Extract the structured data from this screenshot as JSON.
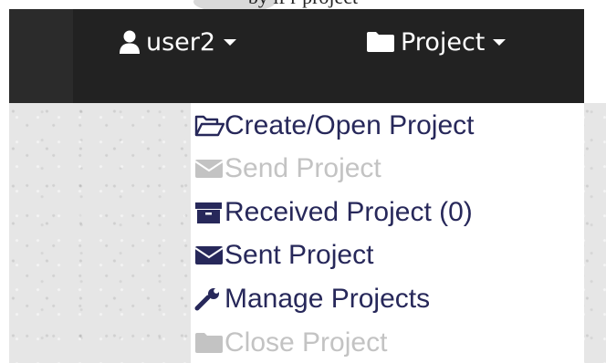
{
  "caption": {
    "text": "by                    lf                   r project"
  },
  "navbar": {
    "user_menu": {
      "label": "user2",
      "icon": "user-icon"
    },
    "project_menu": {
      "label": "Project",
      "icon": "folder-icon"
    }
  },
  "dropdown": {
    "items": [
      {
        "label": "Create/Open Project",
        "icon": "folder-open-icon",
        "enabled": true
      },
      {
        "label": "Send Project",
        "icon": "envelope-icon",
        "enabled": false
      },
      {
        "label": "Received Project (0)",
        "icon": "archive-icon",
        "enabled": true
      },
      {
        "label": "Sent Project",
        "icon": "envelope-icon",
        "enabled": true
      },
      {
        "label": "Manage Projects",
        "icon": "wrench-icon",
        "enabled": true
      },
      {
        "label": "Close Project",
        "icon": "folder-icon",
        "enabled": false
      }
    ]
  },
  "colors": {
    "navbar_bg": "#222222",
    "menu_text": "#27285a",
    "menu_text_disabled": "#c3c3c3"
  }
}
